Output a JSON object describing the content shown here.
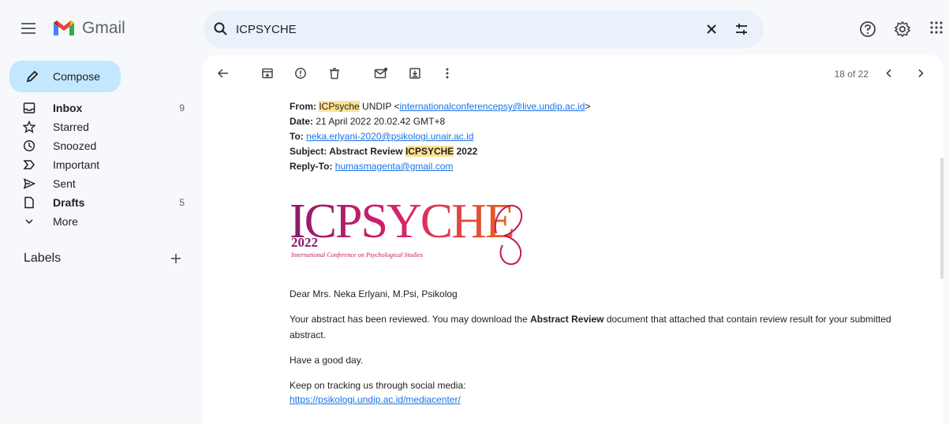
{
  "app": {
    "name": "Gmail"
  },
  "search": {
    "query": "ICPSYCHE"
  },
  "sidebar": {
    "compose_label": "Compose",
    "items": [
      {
        "label": "Inbox",
        "count": "9",
        "bold": true
      },
      {
        "label": "Starred",
        "count": ""
      },
      {
        "label": "Snoozed",
        "count": ""
      },
      {
        "label": "Important",
        "count": ""
      },
      {
        "label": "Sent",
        "count": ""
      },
      {
        "label": "Drafts",
        "count": "5",
        "bold": true
      },
      {
        "label": "More",
        "count": ""
      }
    ],
    "labels_heading": "Labels"
  },
  "toolbar": {
    "pager": "18 of 22"
  },
  "email": {
    "from_label": "From:",
    "from_highlight": "ICPsyche",
    "from_name": " UNDIP <",
    "from_email": "internationalconferencepsy@live.undip.ac.id",
    "from_close": ">",
    "date_label": "Date:",
    "date_value": " 21 April 2022 20.02.42 GMT+8",
    "to_label": "To:",
    "to_email": "neka.erlyani-2020@psikologi.unair.ac.id",
    "subject_label": "Subject: Abstract Review ",
    "subject_highlight": "ICPSYCHE",
    "subject_tail": " 2022",
    "replyto_label": "Reply-To:",
    "replyto_email": "humasmagenta@gmail.com",
    "logo": {
      "main": "ICPSYCHE",
      "year": "2022",
      "tagline": "International Conference on Psychological Studies"
    },
    "greeting": "Dear Mrs. Neka Erlyani, M.Psi, Psikolog",
    "body_1a": "Your abstract has been reviewed. You may download the ",
    "body_1b": "Abstract Review",
    "body_1c": " document that attached that contain review result for your submitted abstract.",
    "body_2": "Have a good day.",
    "body_3": "Keep on tracking us through social media:",
    "body_link": "https://psikologi.undip.ac.id/mediacenter/"
  },
  "colors": {
    "compose_bg": "#c2e7ff",
    "search_bg": "#eaf1fb",
    "highlight": "#fde293",
    "link": "#1a73e8"
  }
}
